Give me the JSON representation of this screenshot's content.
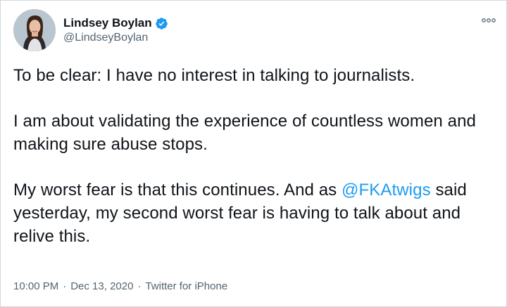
{
  "author": {
    "display_name": "Lindsey Boylan",
    "handle": "@LindseyBoylan",
    "verified": true,
    "avatar_icon": "profile-photo"
  },
  "tweet": {
    "line1": "To be clear: I have no interest in talking to journalists.",
    "line2": "I am about validating the experience of countless women and making sure abuse stops.",
    "line3_before": "My worst fear is that this continues. And as ",
    "mention": "@FKAtwigs",
    "line3_after": " said yesterday, my second worst fear is having to talk about and relive this."
  },
  "meta": {
    "time": "10:00 PM",
    "separator": "·",
    "date": "Dec 13, 2020",
    "source": "Twitter for iPhone"
  },
  "colors": {
    "link": "#1d9bf0",
    "secondary_text": "#536471",
    "border": "#cfd9de",
    "verified_badge": "#1d9bf0"
  },
  "icons": {
    "more": "more-options-icon",
    "verified": "verified-badge-icon"
  }
}
